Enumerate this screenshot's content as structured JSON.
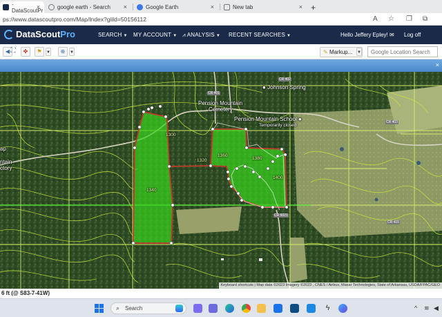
{
  "browser": {
    "tabs": [
      {
        "label": "- DataScoutPr",
        "active": true
      },
      {
        "label": "google earth - Search",
        "active": false
      },
      {
        "label": "Google Earth",
        "active": false
      },
      {
        "label": "New tab",
        "active": false
      }
    ],
    "new_tab": "+",
    "url": "ps://www.datascoutpro.com/Map/Index?giild=50156112",
    "read_aloud": "A",
    "favorite": "☆"
  },
  "app": {
    "logo_main": "DataScout",
    "logo_pro": "Pro",
    "nav": [
      "SEARCH",
      "MY ACCOUNT",
      "ANALYSIS",
      "RECENT SEARCHES"
    ],
    "greeting": "Hello Jeffery Epley!",
    "logoff": "Log off"
  },
  "toolbar": {
    "markup_label": "Markup...",
    "search_placeholder": "Google Location Search"
  },
  "map": {
    "labels": {
      "spring": "Johnson Spring",
      "cemetery_1": "Pension Mountain",
      "cemetery_2": "Cemetery",
      "school": "Pension Mountain School",
      "school_status": "Temporarily closed",
      "left_label": "ap",
      "left_label_2": "ntain",
      "left_label_3": "ctory"
    },
    "road_labels": [
      "CR 401",
      "CR 402",
      "CR 403",
      "CR 415",
      "CR 6021"
    ],
    "contour_labels": [
      "1300",
      "1320",
      "1340",
      "1360",
      "1380",
      "1400"
    ],
    "attribution": "Keyboard shortcuts | Map data ©2023 Imagery ©2023 , CNES / Airbus, Maxar Technologies, State of Arkansas, USDA/FPAC/GEO",
    "coordinates": "6 ft (@ S83-7-41W)"
  },
  "taskbar": {
    "search_placeholder": "Search"
  },
  "colors": {
    "nav_bg": "#1b2a49",
    "parcel_fill": "#39d21e",
    "parcel_border": "#c0392b",
    "contour": "#c8e63c",
    "banner": "#5a95d6"
  }
}
